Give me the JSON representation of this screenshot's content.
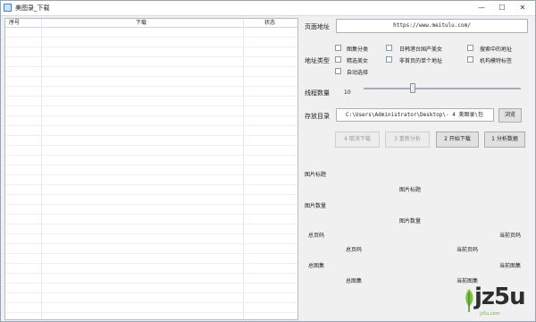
{
  "window": {
    "title": "美图录_下载",
    "controls": {
      "minimize": "—",
      "maximize": "☐",
      "close": "✕"
    }
  },
  "list": {
    "columns": [
      "序号",
      "下载",
      "状态"
    ],
    "rows": []
  },
  "form": {
    "page_url_label": "页面地址",
    "page_url_value": "https://www.meitulu.com/",
    "address_type_label": "地址类型",
    "options": [
      {
        "label": "图集分类",
        "checked": false
      },
      {
        "label": "日韩港台国产美女",
        "checked": false
      },
      {
        "label": "搜索中的地址",
        "checked": false
      },
      {
        "label": "精选美女",
        "checked": false
      },
      {
        "label": "非首页的单个地址",
        "checked": false
      },
      {
        "label": "机构模特标签",
        "checked": false
      },
      {
        "label": "自动选择",
        "checked": false
      }
    ],
    "threads_label": "线程数量",
    "threads_value": "10",
    "threads_level": 0.31,
    "save_dir_label": "存放目录",
    "save_dir_value": "C:\\Users\\Administrator\\Desktop\\- 4 美图录\\包",
    "browse_label": "浏览"
  },
  "buttons": {
    "cancel_download": "4 取消下载",
    "reanalyze": "3 重新分析",
    "start_download": "2 开始下载",
    "analyze_data": "1 分析数据"
  },
  "info": {
    "image_title_label": "图片标题",
    "image_title_value": "图片标题",
    "image_count_label": "图片数量",
    "image_count_value": "图片数量",
    "total_pages_label": "总页码",
    "current_page_label": "当前页码",
    "total_pages_value": "总页码",
    "current_page_value": "当前页码",
    "total_sets_label": "总图集",
    "current_set_label": "当前图集",
    "total_sets_value": "总图集",
    "current_set_value": "当前图集"
  },
  "watermark": {
    "brand": "jz5u",
    "url": "jz5u.com"
  }
}
